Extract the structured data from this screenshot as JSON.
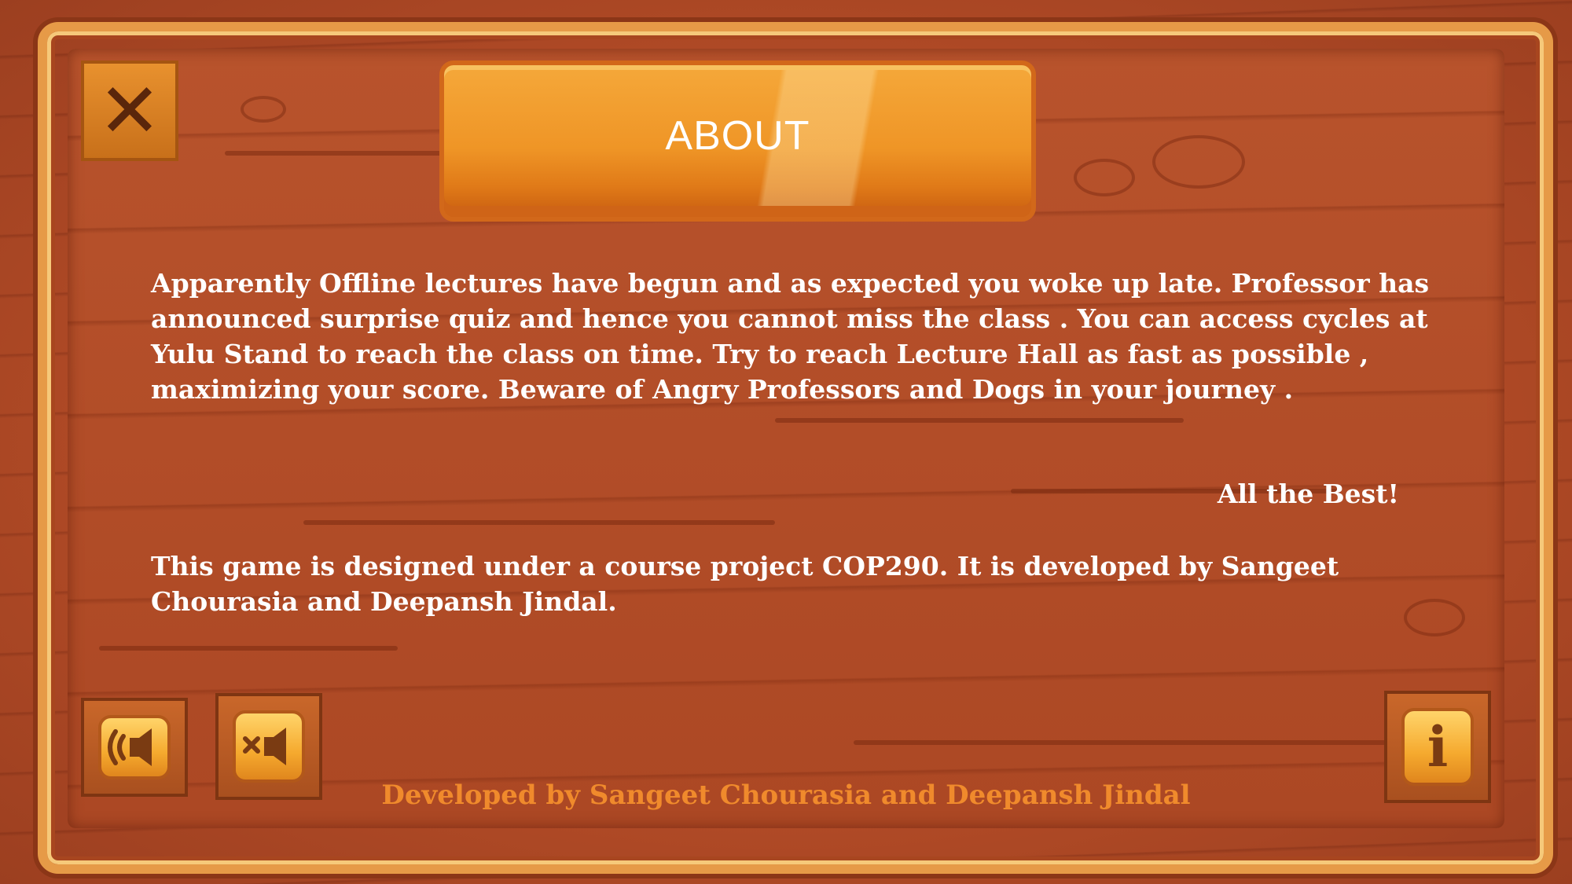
{
  "title": "ABOUT",
  "about_text": "Apparently Offline lectures have begun and as expected you woke up late. Professor has announced surprise quiz and hence you cannot miss the class . You can access cycles at Yulu Stand to reach the class on time. Try to reach Lecture Hall as fast as possible , maximizing your score. Beware of Angry Professors and Dogs in your journey .",
  "best_wishes": "All the Best!",
  "course_text": "This game is designed under a course project COP290. It is developed by Sangeet Chourasia and Deepansh Jindal.",
  "footer_credit": "Developed by Sangeet Chourasia and Deepansh Jindal",
  "buttons": {
    "close": {
      "icon": "close-icon"
    },
    "sound_on": {
      "icon": "speaker-on-icon"
    },
    "sound_off": {
      "icon": "speaker-mute-icon"
    },
    "info": {
      "icon": "info-icon",
      "glyph": "i"
    }
  },
  "colors": {
    "background": "#b24e2b",
    "frame": "#e69a47",
    "banner": "#ef9526",
    "body_text": "#ffffff",
    "footer_text": "#f08a2c"
  }
}
